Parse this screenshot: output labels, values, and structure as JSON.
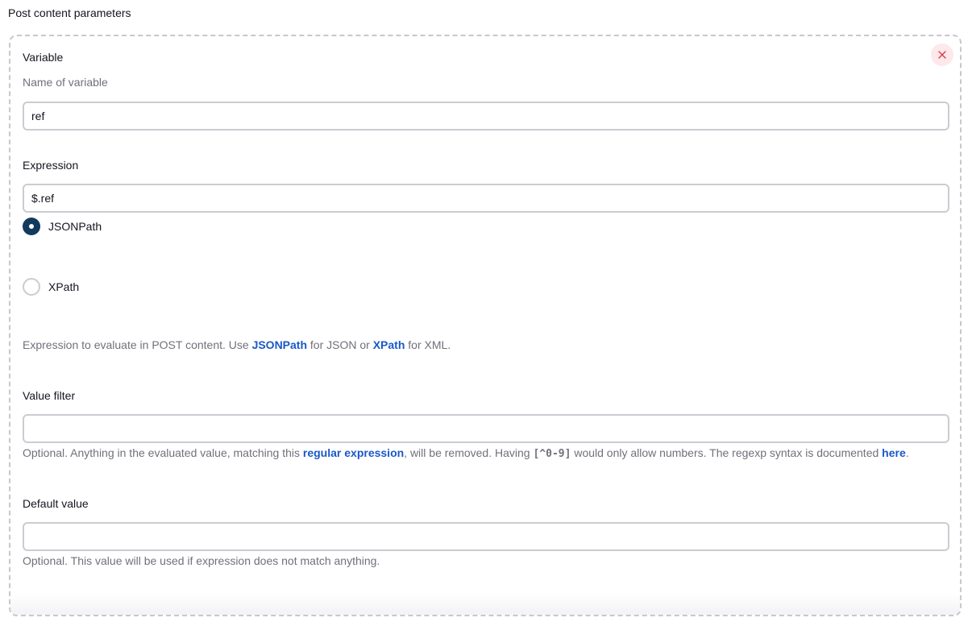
{
  "section": {
    "title": "Post content parameters"
  },
  "card": {
    "delete_icon": "close-icon",
    "delete_color": "#e0394b",
    "variable": {
      "label": "Variable",
      "description": "Name of variable",
      "value": "ref"
    },
    "expression": {
      "label": "Expression",
      "value": "$.ref",
      "options": [
        {
          "label": "JSONPath",
          "selected": true
        },
        {
          "label": "XPath",
          "selected": false
        }
      ],
      "help": {
        "prefix": "Expression to evaluate in POST content. Use ",
        "link1": "JSONPath",
        "middle": " for JSON or ",
        "link2": "XPath",
        "suffix": " for XML."
      }
    },
    "value_filter": {
      "label": "Value filter",
      "value": "",
      "help": {
        "prefix": "Optional. Anything in the evaluated value, matching this ",
        "link1": "regular expression",
        "middle": ", will be removed. Having ",
        "code": "[^0-9]",
        "middle2": " would only allow numbers. The regexp syntax is documented ",
        "link2": "here",
        "suffix": "."
      }
    },
    "default_value": {
      "label": "Default value",
      "value": "",
      "help": "Optional. This value will be used if expression does not match anything."
    }
  },
  "colors": {
    "link": "#1958c8",
    "radio_selected": "#123a5c",
    "muted_text": "#70707b",
    "delete_bg": "#fde8ea"
  }
}
